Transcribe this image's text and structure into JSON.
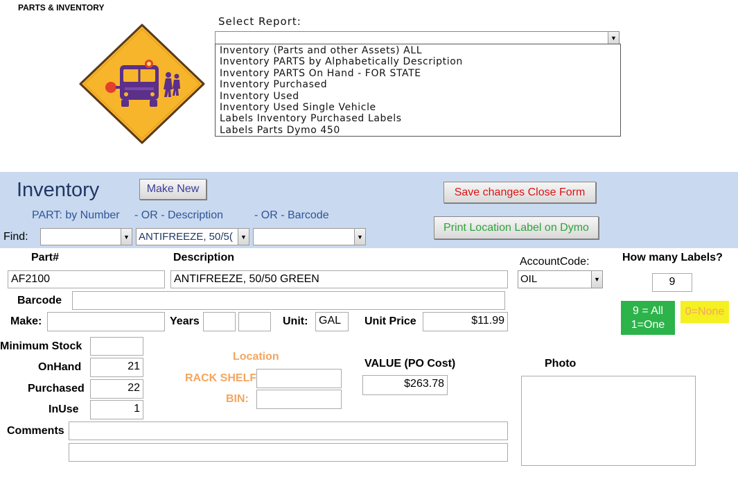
{
  "app_title": "PARTS & INVENTORY",
  "report": {
    "label": "Select Report:",
    "selected": "",
    "options": [
      "Inventory (Parts and other Assets) ALL",
      "Inventory PARTS by Alphabetically Description",
      "Inventory PARTS On Hand -  FOR STATE",
      "Inventory Purchased",
      "Inventory Used",
      "Inventory Used Single Vehicle",
      "Labels Inventory Purchased Labels",
      "Labels Parts  Dymo 450"
    ]
  },
  "form": {
    "title": "Inventory",
    "make_new_label": "Make New",
    "save_close_label": "Save changes Close Form",
    "print_label_button": "Print Location Label on Dymo",
    "find": {
      "label": "Find:",
      "by_number_label": "PART: by Number",
      "or_description_label": "- OR -  Description",
      "or_barcode_label": "- OR - Barcode",
      "part_number_value": "",
      "description_value": "ANTIFREEZE, 50/5(",
      "barcode_value": ""
    }
  },
  "fields": {
    "part_label": "Part#",
    "part_value": "AF2100",
    "description_label": "Description",
    "description_value": "ANTIFREEZE, 50/50 GREEN",
    "account_label": "AccountCode:",
    "account_value": "OIL",
    "labels_count_label": "How many Labels?",
    "labels_count_value": "9",
    "barcode_label": "Barcode",
    "barcode_value": "",
    "make_label": "Make:",
    "make_value": "",
    "years_label": "Years",
    "year_from": "",
    "year_to": "",
    "unit_label": "Unit:",
    "unit_value": "GAL",
    "unit_price_label": "Unit Price",
    "unit_price_value": "$11.99",
    "labels_all_text": "9 = All",
    "labels_one_text": "1=One",
    "labels_none_text": "0=None",
    "min_stock_label": "Minimum Stock",
    "min_stock_value": "",
    "onhand_label": "OnHand",
    "onhand_value": "21",
    "purchased_label": "Purchased",
    "purchased_value": "22",
    "inuse_label": "InUse",
    "inuse_value": "1",
    "location_label": "Location",
    "rack_label": "RACK SHELF:",
    "rack_value": "",
    "bin_label": "BIN:",
    "bin_value": "",
    "value_label": "VALUE (PO Cost)",
    "value_amount": "$263.78",
    "photo_label": "Photo",
    "comments_label": "Comments",
    "comments_line1": "",
    "comments_line2": ""
  },
  "colors": {
    "band": "#c9d9ef",
    "title_blue": "#1f3864",
    "link_blue": "#2f5597",
    "save_red": "#dd1111",
    "print_green": "#2fa33a",
    "location_orange": "#f4a55f",
    "badge_green": "#2cb34a",
    "badge_yellow": "#f5f021",
    "sign_yellow": "#f7b52c"
  },
  "icons": {
    "sign": "school-bus-crossing-sign-icon",
    "dropdown": "dropdown-arrow-icon"
  }
}
